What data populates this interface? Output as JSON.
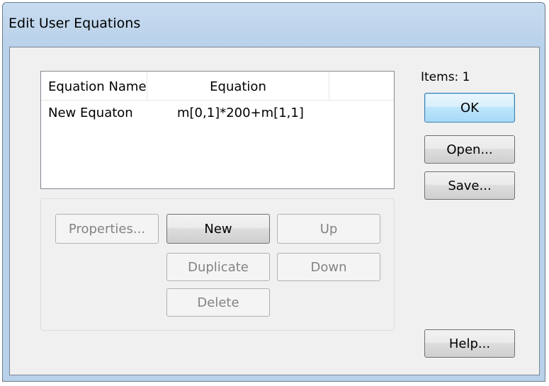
{
  "window": {
    "title": "Edit User Equations"
  },
  "list": {
    "columns": [
      "Equation Name",
      "Equation",
      ""
    ],
    "rows": [
      {
        "name": "New Equaton",
        "equation": "m[0,1]*200+m[1,1]"
      }
    ]
  },
  "items_label": "Items: 1",
  "buttons": {
    "properties": "Properties...",
    "new": "New",
    "up": "Up",
    "duplicate": "Duplicate",
    "down": "Down",
    "delete": "Delete",
    "ok": "OK",
    "open": "Open...",
    "save": "Save...",
    "help": "Help..."
  },
  "colors": {
    "titlebar": "#b9d1ea",
    "dialog_background": "#f0f0f0",
    "default_button_border": "#3c7fb1"
  }
}
